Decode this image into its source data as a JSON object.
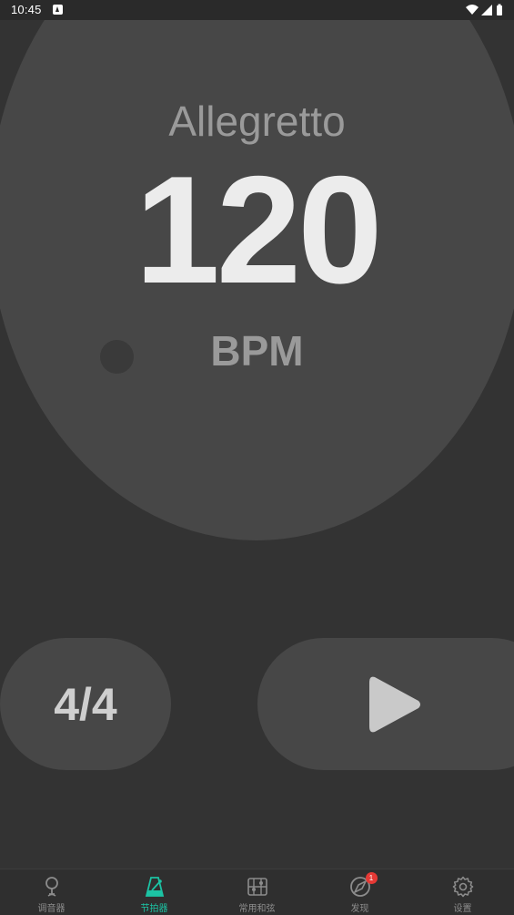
{
  "status_bar": {
    "time": "10:45"
  },
  "metronome": {
    "tempo_name": "Allegretto",
    "bpm": "120",
    "bpm_unit": "BPM",
    "time_signature": "4/4",
    "play_icon": "play-icon"
  },
  "bottom_nav": {
    "items": [
      {
        "label": "调音器",
        "icon": "tuner-icon",
        "active": false
      },
      {
        "label": "节拍器",
        "icon": "metronome-icon",
        "active": true
      },
      {
        "label": "常用和弦",
        "icon": "chord-icon",
        "active": false
      },
      {
        "label": "发现",
        "icon": "compass-icon",
        "active": false,
        "badge": "1"
      },
      {
        "label": "设置",
        "icon": "gear-icon",
        "active": false
      }
    ]
  },
  "colors": {
    "background": "#333333",
    "circle": "#474747",
    "accent": "#1cc3a4",
    "badge": "#e53935"
  }
}
